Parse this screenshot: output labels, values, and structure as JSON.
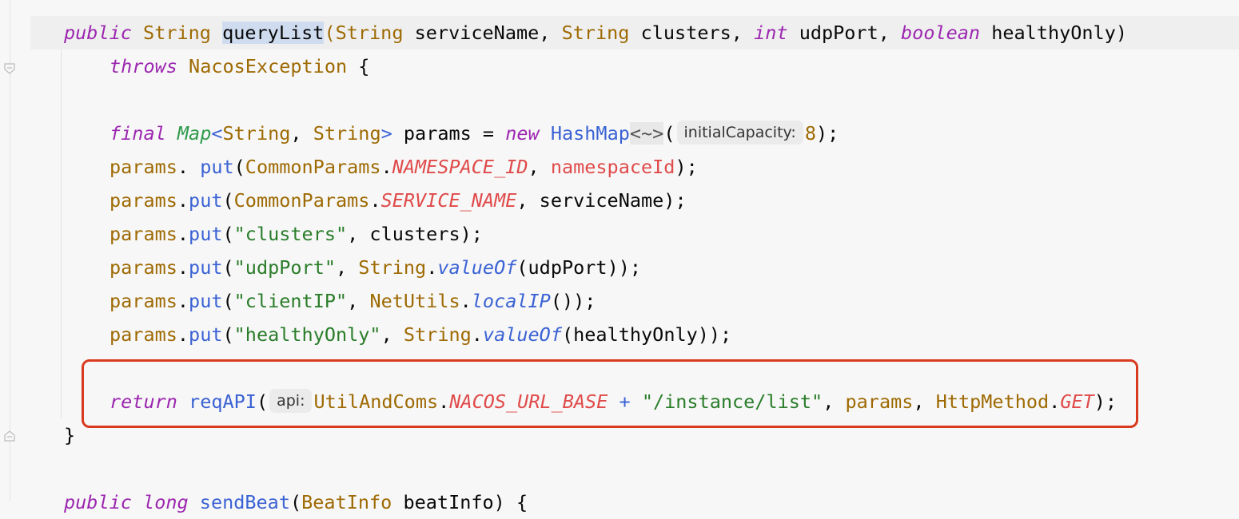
{
  "editor": {
    "lines": [
      {
        "parts": [
          [
            "kw",
            "public"
          ],
          [
            "",
            " "
          ],
          [
            "ty",
            "String"
          ],
          [
            "",
            " "
          ],
          [
            "sel",
            "queryList"
          ],
          [
            "ty",
            "("
          ],
          [
            "ty",
            "String"
          ],
          [
            "",
            " serviceName, "
          ],
          [
            "ty",
            "String"
          ],
          [
            "",
            " clusters, "
          ],
          [
            "kw",
            "int"
          ],
          [
            "",
            " udpPort, "
          ],
          [
            "kw",
            "boolean"
          ],
          [
            "",
            " healthyOnly)"
          ]
        ]
      },
      {
        "parts": [
          [
            "kw",
            "throws"
          ],
          [
            "",
            " "
          ],
          [
            "ty",
            "NacosException"
          ],
          [
            "",
            " {"
          ]
        ]
      },
      {
        "parts": []
      },
      {
        "parts": [
          [
            "kw",
            "final"
          ],
          [
            "",
            " "
          ],
          [
            "gen",
            "Map"
          ],
          [
            "gen2",
            "<"
          ],
          [
            "ty",
            "String"
          ],
          [
            "",
            ", "
          ],
          [
            "ty",
            "String"
          ],
          [
            "gen2",
            ">"
          ],
          [
            "",
            " params = "
          ],
          [
            "kw",
            "new"
          ],
          [
            "",
            " "
          ],
          [
            "gen2",
            "HashMap"
          ],
          [
            "diamond",
            "<~>"
          ],
          [
            "",
            "("
          ],
          [
            "hint",
            "initialCapacity:"
          ],
          [
            "num",
            "8"
          ],
          [
            "",
            ");"
          ]
        ]
      },
      {
        "parts": [
          [
            "ty",
            "params"
          ],
          [
            "",
            ". "
          ],
          [
            "mname",
            "put"
          ],
          [
            "",
            "("
          ],
          [
            "ty",
            "CommonParams"
          ],
          [
            "",
            "."
          ],
          [
            "const",
            "NAMESPACE_ID"
          ],
          [
            "",
            ", "
          ],
          [
            "red",
            "namespaceId"
          ],
          [
            "",
            ");"
          ]
        ]
      },
      {
        "parts": [
          [
            "ty",
            "params"
          ],
          [
            "",
            "."
          ],
          [
            "mname",
            "put"
          ],
          [
            "",
            "("
          ],
          [
            "ty",
            "CommonParams"
          ],
          [
            "",
            "."
          ],
          [
            "const",
            "SERVICE_NAME"
          ],
          [
            "",
            ", serviceName);"
          ]
        ]
      },
      {
        "parts": [
          [
            "ty",
            "params"
          ],
          [
            "",
            "."
          ],
          [
            "mname",
            "put"
          ],
          [
            "",
            "("
          ],
          [
            "str",
            "\"clusters\""
          ],
          [
            "",
            ", clusters);"
          ]
        ]
      },
      {
        "parts": [
          [
            "ty",
            "params"
          ],
          [
            "",
            "."
          ],
          [
            "mname",
            "put"
          ],
          [
            "",
            "("
          ],
          [
            "str",
            "\"udpPort\""
          ],
          [
            "",
            ", "
          ],
          [
            "ty",
            "String"
          ],
          [
            "",
            "."
          ],
          [
            "stat",
            "valueOf"
          ],
          [
            "",
            "(udpPort));"
          ]
        ]
      },
      {
        "parts": [
          [
            "ty",
            "params"
          ],
          [
            "",
            "."
          ],
          [
            "mname",
            "put"
          ],
          [
            "",
            "("
          ],
          [
            "str",
            "\"clientIP\""
          ],
          [
            "",
            ", "
          ],
          [
            "ty",
            "NetUtils"
          ],
          [
            "",
            "."
          ],
          [
            "stat",
            "localIP"
          ],
          [
            "",
            "());"
          ]
        ]
      },
      {
        "parts": [
          [
            "ty",
            "params"
          ],
          [
            "",
            "."
          ],
          [
            "mname",
            "put"
          ],
          [
            "",
            "("
          ],
          [
            "str",
            "\"healthyOnly\""
          ],
          [
            "",
            ", "
          ],
          [
            "ty",
            "String"
          ],
          [
            "",
            "."
          ],
          [
            "stat",
            "valueOf"
          ],
          [
            "",
            "(healthyOnly));"
          ]
        ]
      },
      {
        "parts": []
      },
      {
        "parts": [
          [
            "kw",
            "return"
          ],
          [
            "",
            " "
          ],
          [
            "mname",
            "reqAPI"
          ],
          [
            "",
            "("
          ],
          [
            "hint",
            "api:"
          ],
          [
            "ty",
            "UtilAndComs"
          ],
          [
            "",
            "."
          ],
          [
            "const",
            "NACOS_URL_BASE"
          ],
          [
            "",
            " "
          ],
          [
            "op",
            "+"
          ],
          [
            "",
            " "
          ],
          [
            "str",
            "\"/instance/list\""
          ],
          [
            "",
            ", "
          ],
          [
            "ty",
            "params"
          ],
          [
            "",
            ", "
          ],
          [
            "ty",
            "HttpMethod"
          ],
          [
            "",
            "."
          ],
          [
            "const",
            "GET"
          ],
          [
            "",
            ");"
          ]
        ]
      },
      {
        "parts": [
          [
            "",
            "}"
          ]
        ]
      },
      {
        "parts": []
      },
      {
        "parts": [
          [
            "kw",
            "public"
          ],
          [
            "",
            " "
          ],
          [
            "kw",
            "long"
          ],
          [
            "",
            " "
          ],
          [
            "mname",
            "sendBeat"
          ],
          [
            "",
            "("
          ],
          [
            "ty",
            "BeatInfo"
          ],
          [
            "",
            " beatInfo) {"
          ]
        ]
      }
    ]
  }
}
